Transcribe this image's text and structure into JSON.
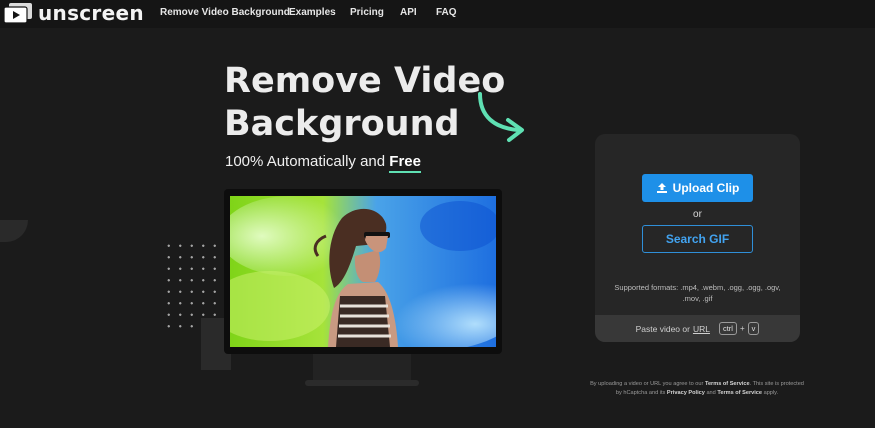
{
  "nav": {
    "brand": "unscreen",
    "links": [
      "Remove Video Background",
      "Examples",
      "Pricing",
      "API",
      "FAQ"
    ]
  },
  "hero": {
    "title_line1": "Remove Video",
    "title_line2": "Background",
    "subtitle_prefix": "100% Automatically and",
    "subtitle_highlight": "Free"
  },
  "upload": {
    "upload_label": "Upload Clip",
    "or_label": "or",
    "search_label": "Search GIF",
    "formats_text": "Supported formats: .mp4, .webm, .ogg, .ogg, .ogv, .mov, .gif",
    "paste_prefix": "Paste video or",
    "paste_url": "URL",
    "key_ctrl": "ctrl",
    "key_plus": "+",
    "key_v": "v"
  },
  "legal": {
    "part1": "By uploading a video or URL you agree to our",
    "terms1": "Terms of Service",
    "part2": ". This site is protected by hCaptcha and its",
    "privacy": "Privacy Policy",
    "part3": "and",
    "terms2": "Terms of Service",
    "part4": "apply."
  },
  "colors": {
    "background": "#1b1b1b",
    "accent_blue": "#1e90e8",
    "accent_mint": "#5fe0b3",
    "panel": "#262626"
  },
  "icons": [
    "play-logo-icon",
    "upload-icon",
    "curved-arrow-icon"
  ]
}
